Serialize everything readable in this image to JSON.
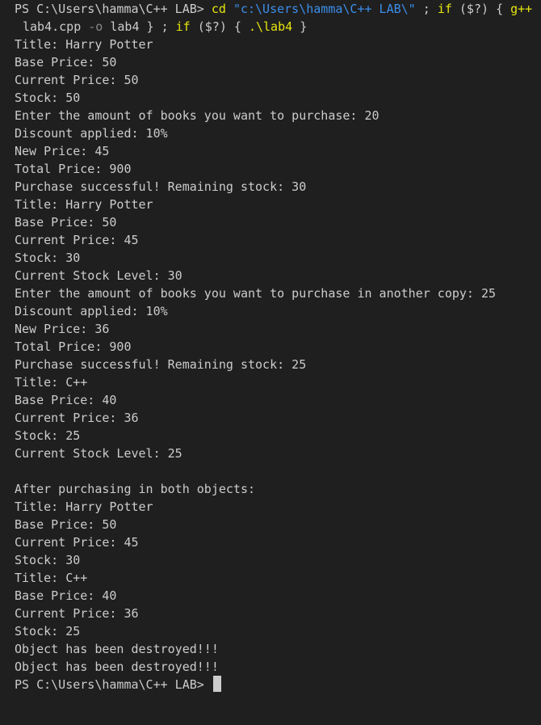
{
  "prompt": "PS C:\\Users\\hamma\\C++ LAB>",
  "command": {
    "cd": "cd",
    "path": "\"c:\\Users\\hamma\\C++ LAB\\\"",
    "sep1": ";",
    "if1": "if",
    "cond1": "($?)",
    "brace_open1": "{",
    "gpp": "g++",
    "src": "lab4.cpp",
    "flag": "-o",
    "out": "lab4",
    "brace_close1": "}",
    "sep2": ";",
    "if2": "if",
    "cond2": "($?)",
    "brace_open2": "{",
    "run": ".\\lab4",
    "brace_close2": "}"
  },
  "output": [
    "Title: Harry Potter",
    "Base Price: 50",
    "Current Price: 50",
    "Stock: 50",
    "Enter the amount of books you want to purchase: 20",
    "Discount applied: 10%",
    "New Price: 45",
    "Total Price: 900",
    "Purchase successful! Remaining stock: 30",
    "Title: Harry Potter",
    "Base Price: 50",
    "Current Price: 45",
    "Stock: 30",
    "Current Stock Level: 30",
    "Enter the amount of books you want to purchase in another copy: 25",
    "Discount applied: 10%",
    "New Price: 36",
    "Total Price: 900",
    "Purchase successful! Remaining stock: 25",
    "Title: C++",
    "Base Price: 40",
    "Current Price: 36",
    "Stock: 25",
    "Current Stock Level: 25",
    "",
    "After purchasing in both objects:",
    "Title: Harry Potter",
    "Base Price: 50",
    "Current Price: 45",
    "Stock: 30",
    "Title: C++",
    "Base Price: 40",
    "Current Price: 36",
    "Stock: 25",
    "Object has been destroyed!!!",
    "Object has been destroyed!!!"
  ],
  "final_prompt": "PS C:\\Users\\hamma\\C++ LAB>",
  "colors": {
    "background": "#1f1f1f",
    "text": "#cccccc",
    "keyword": "#e5e510",
    "string": "#3b8eea",
    "flag": "#8a8a8a"
  }
}
